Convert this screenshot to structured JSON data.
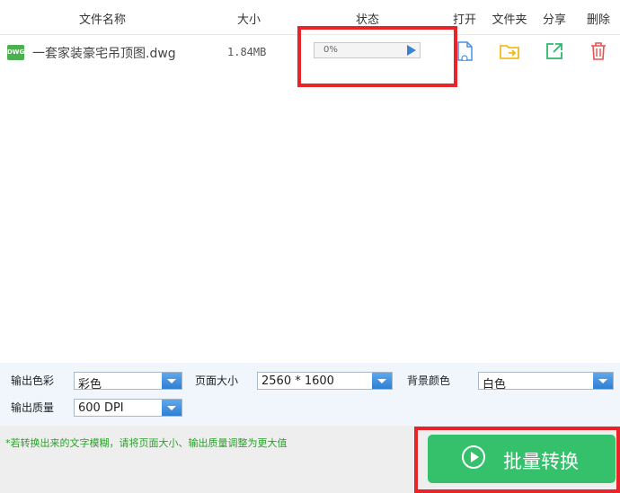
{
  "columns": {
    "name": "文件名称",
    "size": "大小",
    "status": "状态",
    "open": "打开",
    "folder": "文件夹",
    "share": "分享",
    "delete": "删除"
  },
  "files": [
    {
      "type_badge": "DWG",
      "name": "一套家装豪宅吊顶图.dwg",
      "size": "1.84MB",
      "progress_text": "0%",
      "progress": 0
    }
  ],
  "settings": {
    "color_label": "输出色彩",
    "color_value": "彩色",
    "page_size_label": "页面大小",
    "page_size_value": "2560 * 1600",
    "bg_color_label": "背景颜色",
    "bg_color_value": "白色",
    "quality_label": "输出质量",
    "quality_value": "600 DPI"
  },
  "footer": {
    "hint": "*若转换出来的文字模糊，请将页面大小、输出质量调整为更大值",
    "convert_label": "批量转换"
  },
  "colors": {
    "accent_green": "#35c16b",
    "highlight_red": "#e8232a",
    "select_blue": "#2f7fd2"
  }
}
